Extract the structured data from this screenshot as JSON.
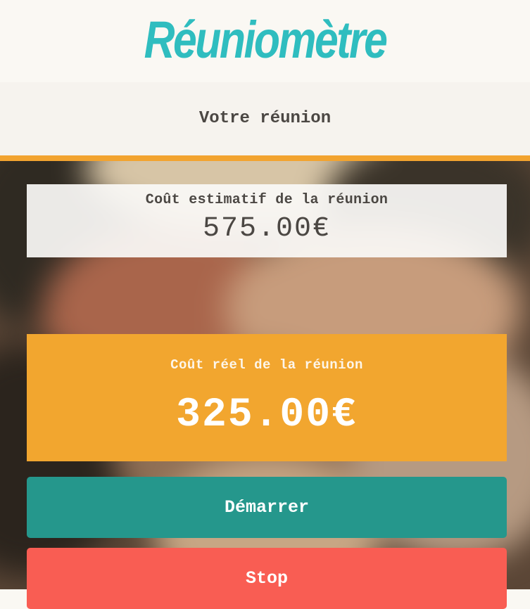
{
  "header": {
    "app_title": "Réuniomètre",
    "section_title": "Votre réunion"
  },
  "estimate": {
    "label": "Coût estimatif de la réunion",
    "value": "575.00€"
  },
  "actual": {
    "label": "Coût réel de la réunion",
    "value": "325.00€"
  },
  "buttons": {
    "start_label": "Démarrer",
    "stop_label": "Stop"
  },
  "colors": {
    "logo": "#2fbdbf",
    "accent": "#f2a32f",
    "actual_card": "#f2a62f",
    "start_button": "#25978c",
    "stop_button": "#f95d53"
  }
}
